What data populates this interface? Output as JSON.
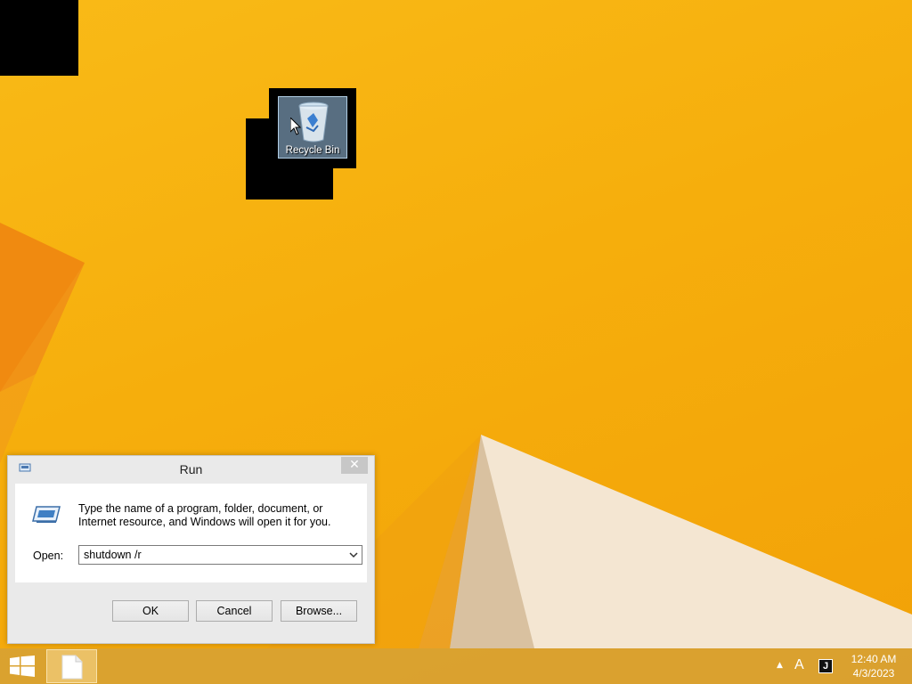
{
  "desktop": {
    "icons": [
      {
        "label": "Recycle Bin",
        "icon": "recycle-bin-icon"
      }
    ]
  },
  "run_dialog": {
    "title": "Run",
    "description": "Type the name of a program, folder, document, or Internet resource, and Windows will open it for you.",
    "open_label": "Open:",
    "open_value": "shutdown /r",
    "buttons": {
      "ok": "OK",
      "cancel": "Cancel",
      "browse": "Browse..."
    },
    "close_glyph": "✕"
  },
  "taskbar": {
    "ime": "A",
    "tray_app_glyph": "J",
    "tray_arrow": "▲",
    "time": "12:40 AM",
    "date": "4/3/2023"
  },
  "colors": {
    "wallpaper": "#f6ae0c",
    "taskbar": "#d2a03c",
    "close_button": "#c7c7c7"
  }
}
